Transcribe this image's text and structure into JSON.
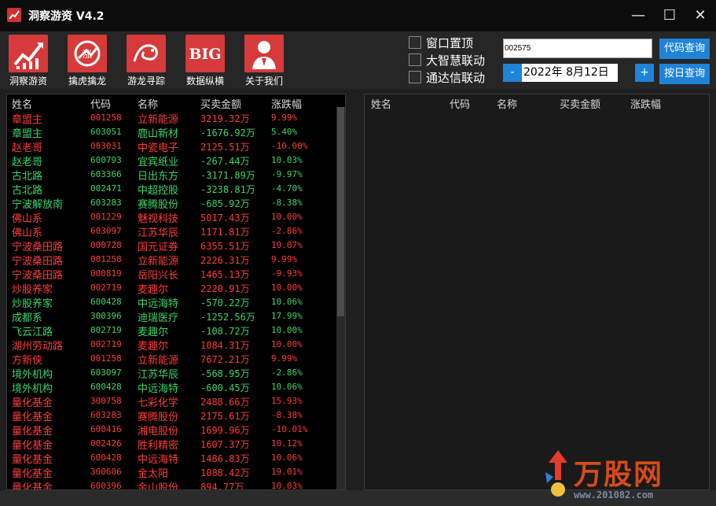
{
  "window": {
    "title": "洞察游资 V4.2",
    "minimize": "—",
    "maximize": "☐",
    "close": "✕"
  },
  "toolbar": [
    {
      "label": "洞察游资",
      "icon": "chart-up-icon"
    },
    {
      "label": "擒虎擒龙",
      "icon": "tiger-icon"
    },
    {
      "label": "游龙寻踪",
      "icon": "dragon-icon"
    },
    {
      "label": "数据纵横",
      "icon": "big-data-icon",
      "tile_text": "BIG"
    },
    {
      "label": "关于我们",
      "icon": "user-icon"
    }
  ],
  "options": {
    "pin_window": "窗口置顶",
    "dzh_link": "大智慧联动",
    "tdx_link": "通达信联动"
  },
  "query": {
    "code_value": "002575",
    "code_button": "代码查询",
    "date_value": "2022年  8月12日",
    "minus": "-",
    "plus": "+",
    "date_button": "按日查询"
  },
  "columns": {
    "name": "姓名",
    "code": "代码",
    "stock": "名称",
    "amount": "买卖金额",
    "change": "涨跌幅"
  },
  "rows": [
    {
      "name": "章盟主",
      "code": "001258",
      "stock": "立新能源",
      "amount": "3219.32万",
      "change": "9.99%",
      "dir": "up"
    },
    {
      "name": "章盟主",
      "code": "603051",
      "stock": "鹿山新材",
      "amount": "-1676.92万",
      "change": "5.40%",
      "dir": "down"
    },
    {
      "name": "赵老哥",
      "code": "003031",
      "stock": "中瓷电子",
      "amount": "2125.51万",
      "change": "-10.00%",
      "dir": "up"
    },
    {
      "name": "赵老哥",
      "code": "600793",
      "stock": "宜宾纸业",
      "amount": "-267.44万",
      "change": "10.03%",
      "dir": "down"
    },
    {
      "name": "古北路",
      "code": "603366",
      "stock": "日出东方",
      "amount": "-3171.89万",
      "change": "-9.97%",
      "dir": "down"
    },
    {
      "name": "古北路",
      "code": "002471",
      "stock": "中超控股",
      "amount": "-3238.81万",
      "change": "-4.70%",
      "dir": "down"
    },
    {
      "name": "宁波解放南",
      "code": "603283",
      "stock": "赛腾股份",
      "amount": "-685.92万",
      "change": "-8.38%",
      "dir": "down"
    },
    {
      "name": "佛山系",
      "code": "001229",
      "stock": "魅视科技",
      "amount": "5017.43万",
      "change": "10.00%",
      "dir": "up"
    },
    {
      "name": "佛山系",
      "code": "603097",
      "stock": "江苏华辰",
      "amount": "1171.81万",
      "change": "-2.86%",
      "dir": "up"
    },
    {
      "name": "宁波桑田路",
      "code": "000728",
      "stock": "国元证券",
      "amount": "6355.51万",
      "change": "10.07%",
      "dir": "up"
    },
    {
      "name": "宁波桑田路",
      "code": "001258",
      "stock": "立新能源",
      "amount": "2226.31万",
      "change": "9.99%",
      "dir": "up"
    },
    {
      "name": "宁波桑田路",
      "code": "000819",
      "stock": "岳阳兴长",
      "amount": "1465.13万",
      "change": "-9.93%",
      "dir": "up"
    },
    {
      "name": "炒股养家",
      "code": "002719",
      "stock": "麦趣尔",
      "amount": "2220.91万",
      "change": "10.00%",
      "dir": "up"
    },
    {
      "name": "炒股养家",
      "code": "600428",
      "stock": "中远海特",
      "amount": "-570.22万",
      "change": "10.06%",
      "dir": "down"
    },
    {
      "name": "成都系",
      "code": "300396",
      "stock": "迪瑞医疗",
      "amount": "-1252.56万",
      "change": "17.99%",
      "dir": "down"
    },
    {
      "name": "飞云江路",
      "code": "002719",
      "stock": "麦趣尔",
      "amount": "-108.72万",
      "change": "10.00%",
      "dir": "down"
    },
    {
      "name": "湖州劳动路",
      "code": "002719",
      "stock": "麦趣尔",
      "amount": "1084.31万",
      "change": "10.00%",
      "dir": "up"
    },
    {
      "name": "方新侠",
      "code": "001258",
      "stock": "立新能源",
      "amount": "7672.21万",
      "change": "9.99%",
      "dir": "up"
    },
    {
      "name": "境外机构",
      "code": "603097",
      "stock": "江苏华辰",
      "amount": "-568.95万",
      "change": "-2.86%",
      "dir": "down"
    },
    {
      "name": "境外机构",
      "code": "600428",
      "stock": "中远海特",
      "amount": "-600.45万",
      "change": "10.06%",
      "dir": "down"
    },
    {
      "name": "量化基金",
      "code": "300758",
      "stock": "七彩化学",
      "amount": "2488.66万",
      "change": "15.93%",
      "dir": "up"
    },
    {
      "name": "量化基金",
      "code": "603283",
      "stock": "赛腾股份",
      "amount": "2175.61万",
      "change": "-8.38%",
      "dir": "up"
    },
    {
      "name": "量化基金",
      "code": "600416",
      "stock": "湘电股份",
      "amount": "1699.96万",
      "change": "-10.01%",
      "dir": "up"
    },
    {
      "name": "量化基金",
      "code": "002426",
      "stock": "胜利精密",
      "amount": "1607.37万",
      "change": "10.12%",
      "dir": "up"
    },
    {
      "name": "量化基金",
      "code": "600428",
      "stock": "中远海特",
      "amount": "1486.83万",
      "change": "10.06%",
      "dir": "up"
    },
    {
      "name": "量化基金",
      "code": "300606",
      "stock": "金太阳",
      "amount": "1088.42万",
      "change": "19.01%",
      "dir": "up"
    },
    {
      "name": "量化基金",
      "code": "600396",
      "stock": "金山股份",
      "amount": "894.77万",
      "change": "10.03%",
      "dir": "up"
    }
  ],
  "watermark": {
    "brand": "万股网",
    "url": "www.201082.com"
  },
  "colors": {
    "up": "#ff3b3b",
    "down": "#3cd46a",
    "accent": "#1f83d8",
    "tile": "#d63a3a"
  }
}
